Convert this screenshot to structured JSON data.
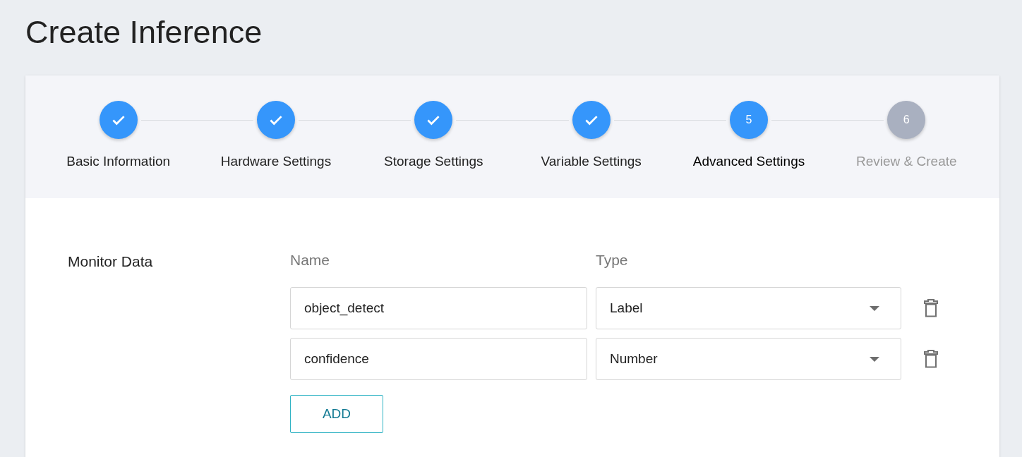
{
  "page": {
    "title": "Create Inference"
  },
  "steps": [
    {
      "label": "Basic Information",
      "completed": true,
      "selected": false
    },
    {
      "label": "Hardware Settings",
      "completed": true,
      "selected": false
    },
    {
      "label": "Storage Settings",
      "completed": true,
      "selected": false
    },
    {
      "label": "Variable Settings",
      "completed": true,
      "selected": false
    },
    {
      "label": "Advanced Settings",
      "number": "5",
      "completed": false,
      "selected": true
    },
    {
      "label": "Review & Create",
      "number": "6",
      "completed": false,
      "selected": false
    }
  ],
  "monitor_data": {
    "label": "Monitor Data",
    "columns": [
      "Name",
      "Type"
    ],
    "rows": [
      {
        "name": "object_detect",
        "type": "Label"
      },
      {
        "name": "confidence",
        "type": "Number"
      }
    ],
    "add_button": "ADD"
  }
}
